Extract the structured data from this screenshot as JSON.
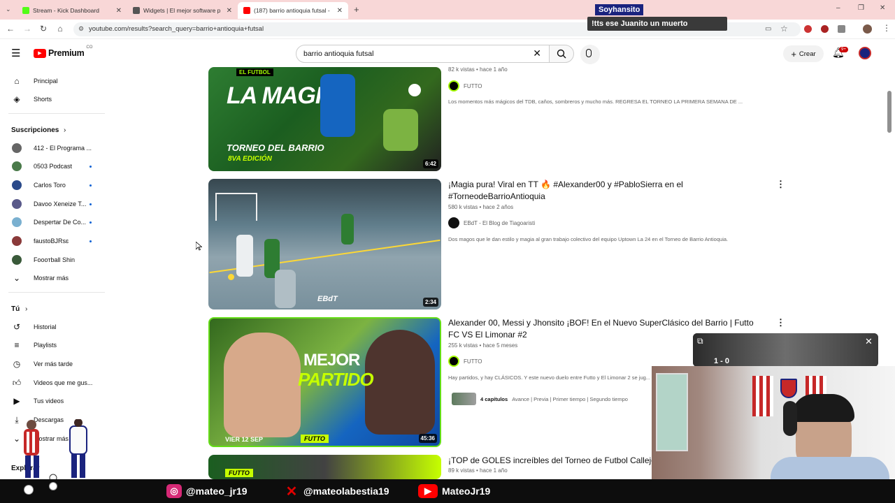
{
  "browser": {
    "tabs": [
      {
        "title": "Stream - Kick Dashboard",
        "color": "#53fc18"
      },
      {
        "title": "Widgets | El mejor software par",
        "color": "#555555"
      },
      {
        "title": "(187) barrio antioquia futsal - Y",
        "color": "#ff0000"
      }
    ],
    "new_tab_icon": "plus-icon",
    "url": "youtube.com/results?search_query=barrio+antioquia+futsal"
  },
  "youtube": {
    "logo_text": "Premium",
    "logo_country": "CO",
    "search_query": "barrio antioquia futsal",
    "create_label": "Crear",
    "notif_badge": "9+"
  },
  "sidebar": {
    "top_items": [
      {
        "label": "Principal",
        "icon": "home-icon"
      },
      {
        "label": "Shorts",
        "icon": "shorts-icon"
      }
    ],
    "subs_header": "Suscripciones",
    "subscriptions": [
      {
        "label": "412 - El Programa ...",
        "color": "#666666",
        "dot": false
      },
      {
        "label": "0503 Podcast",
        "color": "#4a7a4a",
        "dot": true
      },
      {
        "label": "Carlos Toro",
        "color": "#2a4a8a",
        "dot": true
      },
      {
        "label": "Davoo Xeneize T...",
        "color": "#5a5a8a",
        "dot": true
      },
      {
        "label": "Despertar De Co...",
        "color": "#7ab0d0",
        "dot": true
      },
      {
        "label": "faustoBJRsɛ",
        "color": "#8a3a3a",
        "dot": true
      },
      {
        "label": "Fooотball Shin",
        "color": "#3a5a3a",
        "dot": false
      }
    ],
    "show_more": "Mostrar más",
    "you_header": "Tú",
    "you_items": [
      {
        "label": "Historial",
        "icon": "history-icon"
      },
      {
        "label": "Playlists",
        "icon": "playlist-icon"
      },
      {
        "label": "Ver más tarde",
        "icon": "clock-icon"
      },
      {
        "label": "Videos que me gus...",
        "icon": "like-icon"
      },
      {
        "label": "Tus videos",
        "icon": "video-icon"
      },
      {
        "label": "Descargas",
        "icon": "download-icon"
      },
      {
        "label": "Mostrar más",
        "icon": "chevron-down-icon"
      }
    ],
    "explore_header": "Explorar"
  },
  "results": [
    {
      "thumb_text_1": "LA MAGIA",
      "thumb_text_2": "TORNEO DEL BARRIO",
      "thumb_text_3": "8VA EDICIÓN",
      "thumb_badge": "EL FUTBOL",
      "duration": "6:42",
      "views": "82 k vistas",
      "age": "hace 1 año",
      "channel": "FUTTO",
      "desc": "Los momentos más mágicos del TDB, caños, sombreros y mucho más. REGRESA EL TORNEO LA PRIMERA SEMANA DE ..."
    },
    {
      "title": "¡Magia pura! Viral en TT 🔥 #Alexander00 y #PabloSierra en el #TorneodeBarrioAntioquia",
      "thumb_text_1": "EBdT",
      "duration": "2:34",
      "views": "580 k vistas",
      "age": "hace 2 años",
      "channel": "EBdT - El Blog de Tiagoaristi",
      "desc": "Dos magos que le dan estilo y magia al gran trabajo colectivo del equipo Uptown La 24 en el Torneo de Barrio Antioquia."
    },
    {
      "title": "Alexander 00, Messi y Jhonsito ¡BOF! En el Nuevo SuperClásico del Barrio | Futto FC VS El Limonar #2",
      "thumb_text_1": "MEJOR",
      "thumb_text_2": "PARTIDO",
      "thumb_text_3": "VIER 12 SEP",
      "thumb_text_4": "FUTTO",
      "duration": "45:36",
      "views": "255 k vistas",
      "age": "hace 5 meses",
      "channel": "FUTTO",
      "desc": "Hay partidos, y hay CLÁSICOS. Y este nuevo duelo entre Futto y El Limonar 2 se jug...",
      "chapters_label": "4 capítulos",
      "chapters": "Avance | Previa | Primer tiempo | Segundo tiempo"
    },
    {
      "title": "¡TOP de GOLES increíbles del Torneo de Futbol Callejer...",
      "thumb_text_1": "FUTTO",
      "views": "89 k vistas",
      "age": "hace 1 año"
    }
  ],
  "overlay": {
    "chat_user": "Soyhansito",
    "chat_msg": "!tts ese Juanito un muerto",
    "mini_score": "1 - 0",
    "socials": [
      {
        "handle": "@mateo_jr19",
        "icon": "instagram-icon",
        "color": "#d62976"
      },
      {
        "handle": "@mateolabestia19",
        "icon": "x-icon",
        "color": "#e00000"
      },
      {
        "handle": "MateoJr19",
        "icon": "youtube-icon",
        "color": "#ff0000"
      }
    ]
  }
}
